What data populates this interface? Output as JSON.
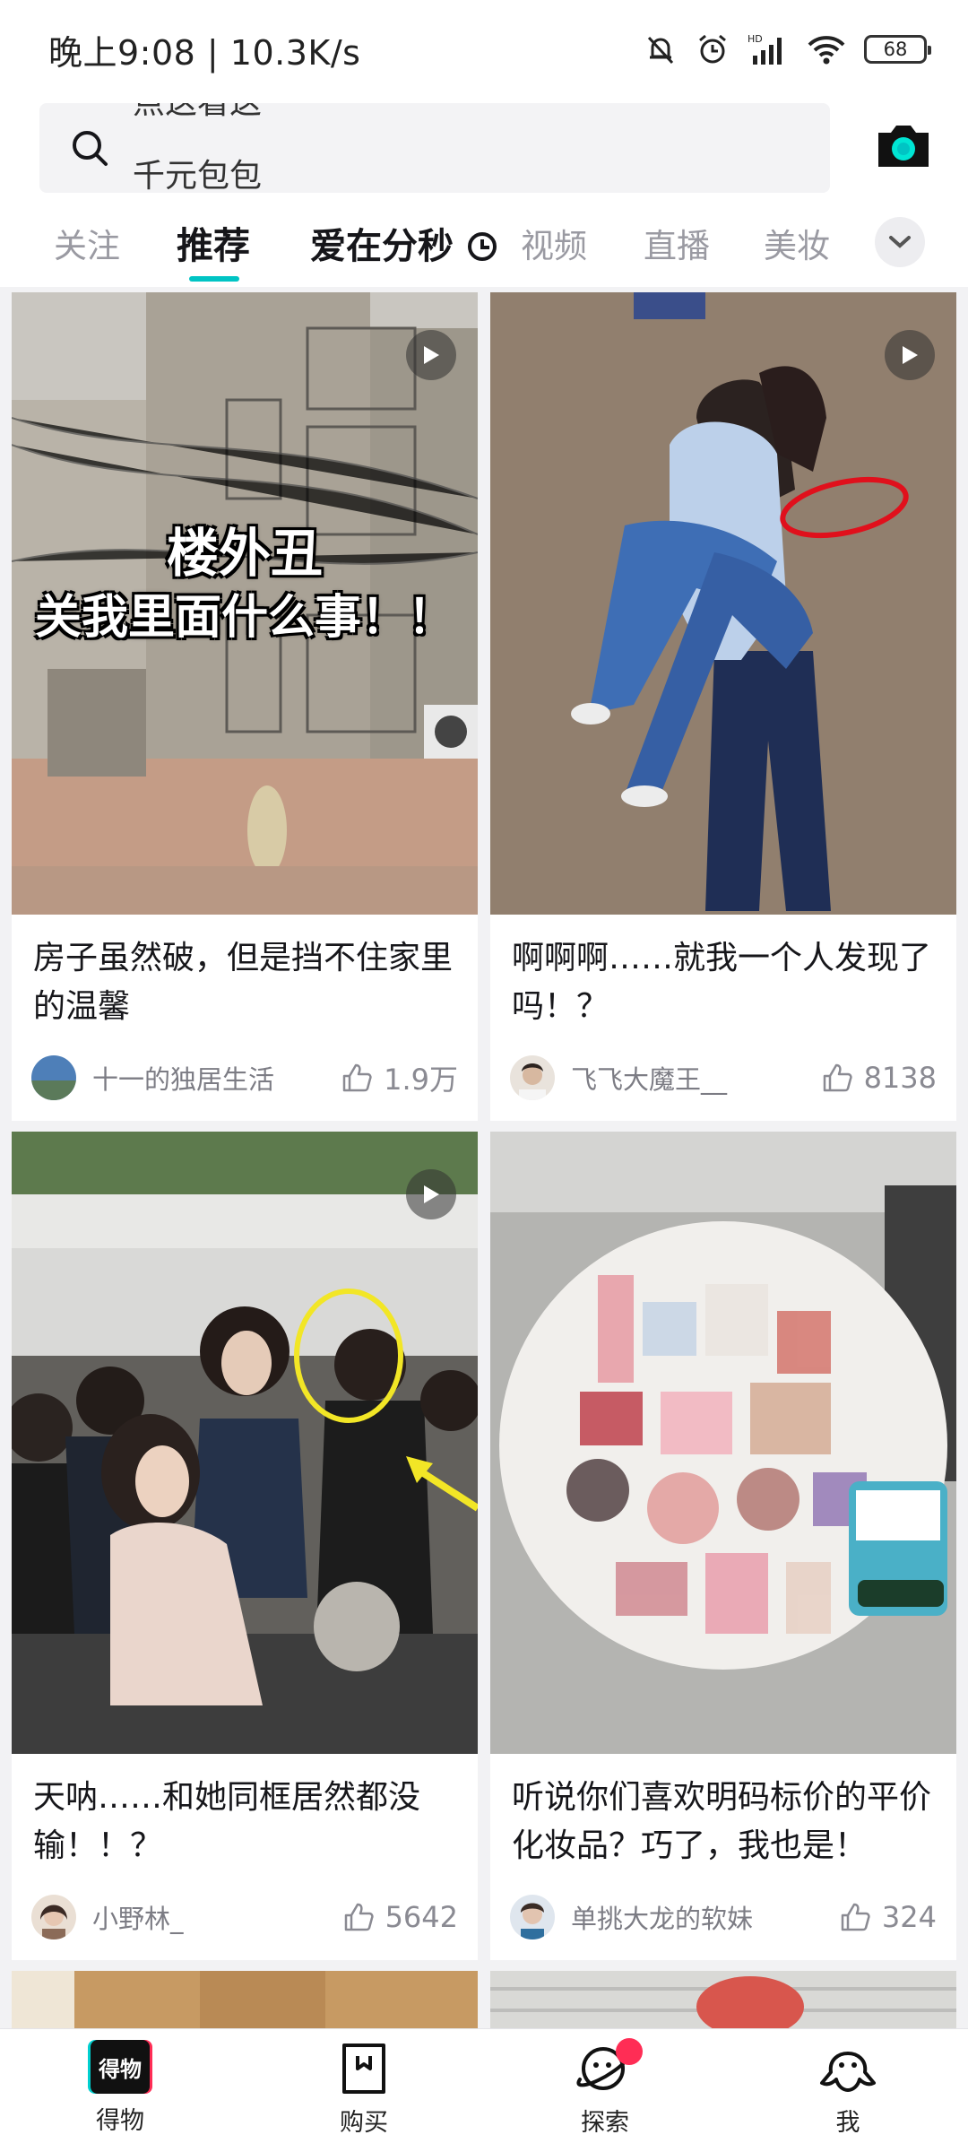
{
  "status_bar": {
    "time_speed": "晚上9:08 | 10.3K/s",
    "battery": "68",
    "network_badge": "HD"
  },
  "search": {
    "rolling_top": "点这看这",
    "placeholder": "千元包包"
  },
  "tabs": [
    "关注",
    "推荐",
    "爱在分秒",
    "视频",
    "直播",
    "美妆"
  ],
  "active_tab_index": 1,
  "colors": {
    "accent": "#00c4c4",
    "badge_red": "#ff2d55",
    "text_primary": "#16161a",
    "text_secondary": "#7c7c84"
  },
  "cards": [
    {
      "overlay_line1": "楼外丑",
      "overlay_line2": "关我里面什么事！！",
      "title": "房子虽然破，但是挡不住家里的温馨",
      "author": "十一的独居生活",
      "likes": "1.9万"
    },
    {
      "title": "啊啊啊……就我一个人发现了吗！？",
      "author": "飞飞大魔王__",
      "likes": "8138"
    },
    {
      "title": "天呐……和她同框居然都没输！！？",
      "author": "小野林_",
      "likes": "5642"
    },
    {
      "title": "听说你们喜欢明码标价的平价化妆品？巧了，我也是！",
      "author": "单挑大龙的软妹",
      "likes": "324"
    }
  ],
  "bottom_nav": [
    {
      "label": "得物",
      "icon": "dewu-logo-icon"
    },
    {
      "label": "购买",
      "icon": "shopping-bag-icon"
    },
    {
      "label": "探索",
      "icon": "planet-icon"
    },
    {
      "label": "我",
      "icon": "octopus-icon"
    }
  ],
  "nav_logo_text": "得物"
}
